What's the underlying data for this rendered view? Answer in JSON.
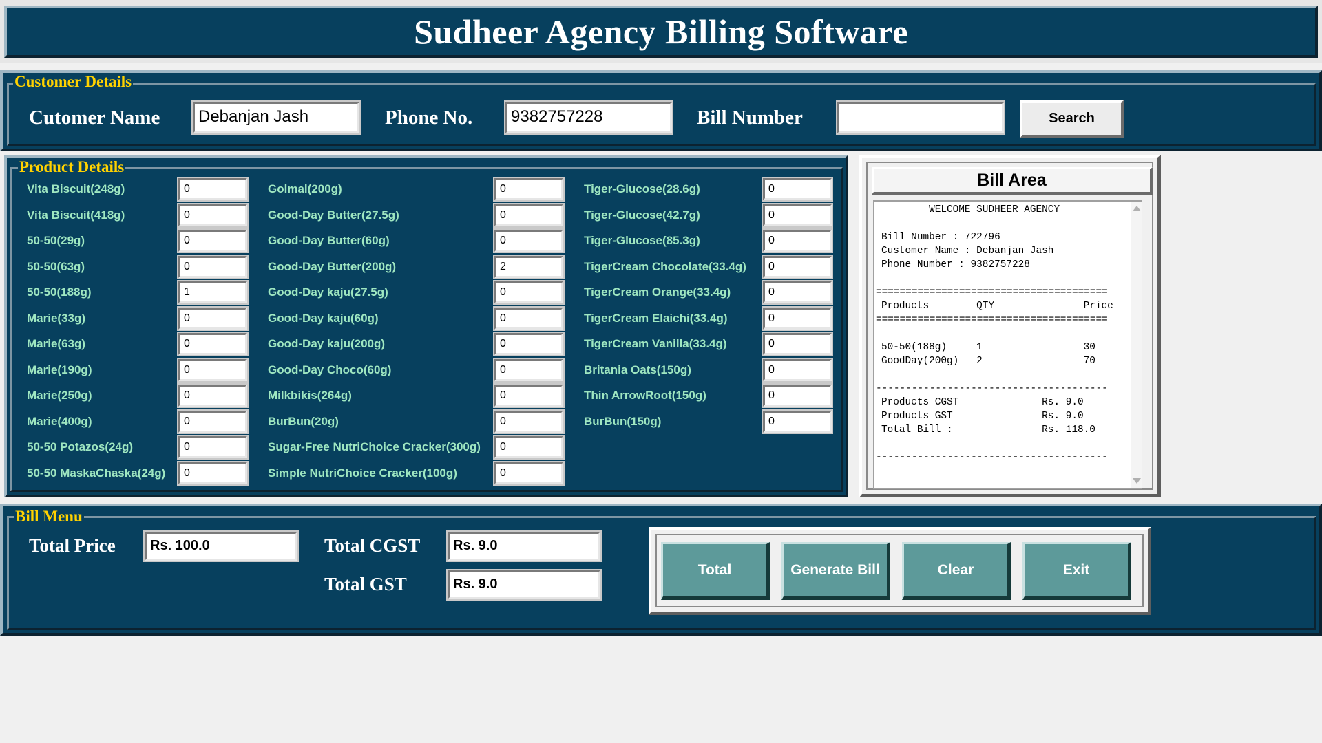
{
  "app": {
    "title": "Sudheer Agency Billing Software"
  },
  "customer": {
    "legend": "Customer Details",
    "name_label": "Cutomer Name",
    "name_value": "Debanjan Jash",
    "phone_label": "Phone No.",
    "phone_value": "9382757228",
    "bill_label": "Bill Number",
    "bill_value": "",
    "search_label": "Search"
  },
  "products": {
    "legend": "Product Details",
    "col1": [
      {
        "label": "Vita Biscuit(248g)",
        "qty": "0"
      },
      {
        "label": "Vita Biscuit(418g)",
        "qty": "0"
      },
      {
        "label": "50-50(29g)",
        "qty": "0"
      },
      {
        "label": "50-50(63g)",
        "qty": "0"
      },
      {
        "label": "50-50(188g)",
        "qty": "1"
      },
      {
        "label": "Marie(33g)",
        "qty": "0"
      },
      {
        "label": "Marie(63g)",
        "qty": "0"
      },
      {
        "label": "Marie(190g)",
        "qty": "0"
      },
      {
        "label": "Marie(250g)",
        "qty": "0"
      },
      {
        "label": "Marie(400g)",
        "qty": "0"
      },
      {
        "label": "50-50 Potazos(24g)",
        "qty": "0"
      },
      {
        "label": "50-50 MaskaChaska(24g)",
        "qty": "0"
      }
    ],
    "col2": [
      {
        "label": "Golmal(200g)",
        "qty": "0"
      },
      {
        "label": "Good-Day Butter(27.5g)",
        "qty": "0"
      },
      {
        "label": "Good-Day Butter(60g)",
        "qty": "0"
      },
      {
        "label": "Good-Day Butter(200g)",
        "qty": "2"
      },
      {
        "label": "Good-Day kaju(27.5g)",
        "qty": "0"
      },
      {
        "label": "Good-Day kaju(60g)",
        "qty": "0"
      },
      {
        "label": "Good-Day kaju(200g)",
        "qty": "0"
      },
      {
        "label": "Good-Day Choco(60g)",
        "qty": "0"
      },
      {
        "label": "Milkbikis(264g)",
        "qty": "0"
      },
      {
        "label": "BurBun(20g)",
        "qty": "0"
      },
      {
        "label": "Sugar-Free NutriChoice Cracker(300g)",
        "qty": "0"
      },
      {
        "label": "Simple NutriChoice Cracker(100g)",
        "qty": "0"
      }
    ],
    "col3": [
      {
        "label": "Tiger-Glucose(28.6g)",
        "qty": "0"
      },
      {
        "label": "Tiger-Glucose(42.7g)",
        "qty": "0"
      },
      {
        "label": "Tiger-Glucose(85.3g)",
        "qty": "0"
      },
      {
        "label": "TigerCream Chocolate(33.4g)",
        "qty": "0"
      },
      {
        "label": "TigerCream Orange(33.4g)",
        "qty": "0"
      },
      {
        "label": "TigerCream Elaichi(33.4g)",
        "qty": "0"
      },
      {
        "label": "TigerCream Vanilla(33.4g)",
        "qty": "0"
      },
      {
        "label": "Britania Oats(150g)",
        "qty": "0"
      },
      {
        "label": "Thin ArrowRoot(150g)",
        "qty": "0"
      },
      {
        "label": "BurBun(150g)",
        "qty": "0"
      }
    ]
  },
  "bill_area": {
    "heading": "Bill Area",
    "lines": [
      "        WELCOME SUDHEER AGENCY",
      "",
      "Bill Number : 722796",
      "Customer Name : Debanjan Jash",
      "Phone Number : 9382757228",
      "",
      "=======================================",
      "Products        QTY               Price",
      "=======================================",
      "",
      "50-50(188g)     1                 30",
      "GoodDay(200g)   2                 70",
      "",
      "---------------------------------------",
      "Products CGST              Rs. 9.0",
      "Products GST               Rs. 9.0",
      "Total Bill :               Rs. 118.0",
      "",
      "---------------------------------------"
    ]
  },
  "bill_menu": {
    "legend": "Bill Menu",
    "total_price_label": "Total Price",
    "total_price_value": "Rs. 100.0",
    "total_cgst_label": "Total CGST",
    "total_cgst_value": "Rs. 9.0",
    "total_gst_label": "Total GST",
    "total_gst_value": "Rs. 9.0",
    "buttons": {
      "total": "Total",
      "generate": "Generate Bill",
      "clear": "Clear",
      "exit": "Exit"
    }
  },
  "colors": {
    "panel_bg": "#07405e",
    "legend_text": "#ffd200",
    "product_text": "#9fe7c1",
    "button_teal": "#5d9a9a"
  },
  "icons": [
    "scroll-up-arrow-icon",
    "scroll-down-arrow-icon"
  ]
}
